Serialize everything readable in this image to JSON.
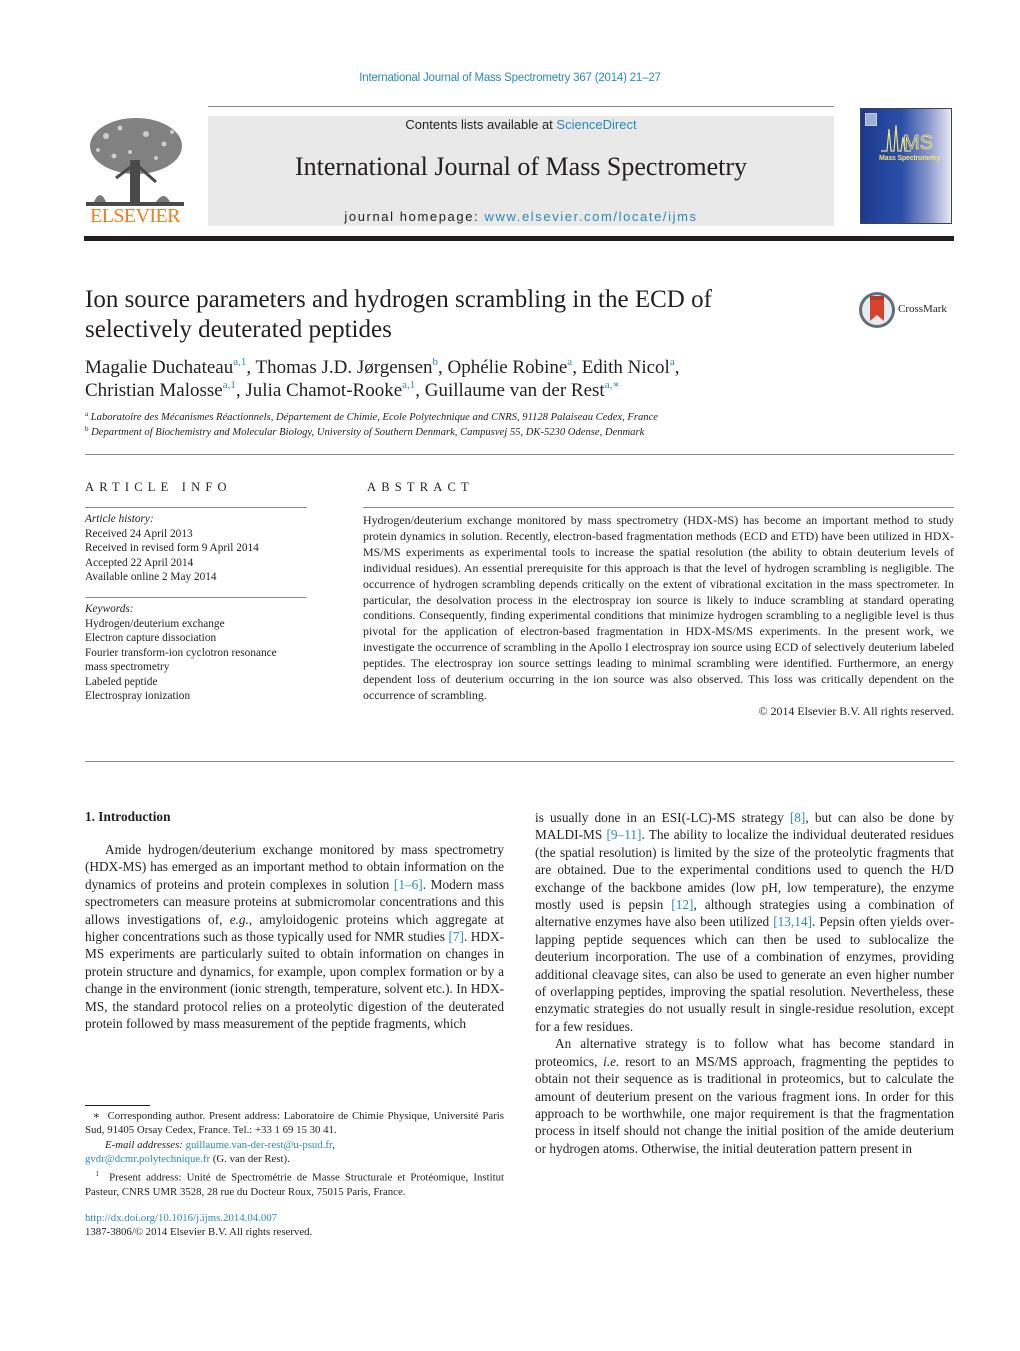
{
  "running_header": "International Journal of Mass Spectrometry 367 (2014) 21–27",
  "masthead": {
    "publisher_logo_text": "ELSEVIER",
    "contents_prefix": "Contents lists available at ",
    "contents_link": "ScienceDirect",
    "journal_name": "International Journal of Mass Spectrometry",
    "homepage_prefix": "journal homepage: ",
    "homepage_link": "www.elsevier.com/locate/ijms",
    "cover_title": "Mass Spectrometry"
  },
  "article": {
    "title_line1": "Ion source parameters and hydrogen scrambling in the ECD of",
    "title_line2": "selectively deuterated peptides",
    "crossmark_label": "CrossMark",
    "authors": [
      {
        "name": "Magalie Duchateau",
        "sup": "a,1",
        "sep": ", "
      },
      {
        "name": "Thomas J.D. Jørgensen",
        "sup": "b",
        "sep": ", "
      },
      {
        "name": "Ophélie Robine",
        "sup": "a",
        "sep": ", "
      },
      {
        "name": "Edith Nicol",
        "sup": "a",
        "sep": ","
      },
      {
        "name": "Christian Malosse",
        "sup": "a,1",
        "sep": ", "
      },
      {
        "name": "Julia Chamot-Rooke",
        "sup": "a,1",
        "sep": ", "
      },
      {
        "name": "Guillaume van der Rest",
        "sup": "a,∗",
        "sep": ""
      }
    ],
    "affiliations": [
      {
        "label": "a",
        "text": "Laboratoire des Mécanismes Réactionnels, Département de Chimie, Ecole Polytechnique and CNRS, 91128 Palaiseau Cedex, France"
      },
      {
        "label": "b",
        "text": "Department of Biochemistry and Molecular Biology, University of Southern Denmark, Campusvej 55, DK-5230 Odense, Denmark"
      }
    ]
  },
  "article_info": {
    "heading": "ARTICLE INFO",
    "history_label": "Article history:",
    "history": [
      "Received 24 April 2013",
      "Received in revised form 9 April 2014",
      "Accepted 22 April 2014",
      "Available online 2 May 2014"
    ],
    "keywords_label": "Keywords:",
    "keywords": [
      "Hydrogen/deuterium exchange",
      "Electron capture dissociation",
      "Fourier transform-ion cyclotron resonance",
      "mass spectrometry",
      "Labeled peptide",
      "Electrospray ionization"
    ]
  },
  "abstract": {
    "heading": "ABSTRACT",
    "text": "Hydrogen/deuterium exchange monitored by mass spectrometry (HDX-MS) has become an important method to study protein dynamics in solution. Recently, electron-based fragmentation methods (ECD and ETD) have been utilized in HDX-MS/MS experiments as experimental tools to increase the spatial resolution (the ability to obtain deuterium levels of individual residues). An essential prerequisite for this approach is that the level of hydrogen scrambling is negligible. The occurrence of hydrogen scram­bling depends critically on the extent of vibrational excitation in the mass spectrometer. In particular, the desolvation process in the electrospray ion source is likely to induce scrambling at standard operat­ing conditions. Consequently, finding experimental conditions that minimize hydrogen scrambling to a negligible level is thus pivotal for the application of electron-based fragmentation in HDX-MS/MS exper­iments. In the present work, we investigate the occurrence of scrambling in the Apollo I electrospray ion source using ECD of selectively deuterium labeled peptides. The electrospray ion source settings leading to minimal scrambling were identified. Furthermore, an energy dependent loss of deuterium occurring in the ion source was also observed. This loss was critically dependent on the occurrence of scrambling.",
    "copyright": "© 2014 Elsevier B.V. All rights reserved."
  },
  "introduction": {
    "heading": "1.  Introduction",
    "left_p1": [
      {
        "t": "Amide hydrogen/deuterium exchange monitored by mass spec­trometry (HDX-MS) has emerged as an important method to obtain information on the dynamics of proteins and protein complexes in solution "
      },
      {
        "ref": "[1–6]"
      },
      {
        "t": ". Modern mass spectrometers can measure proteins at submicromolar concentrations and this allows investigations of, "
      },
      {
        "i": "e.g."
      },
      {
        "t": ", amyloidogenic proteins which aggregate at higher con­centrations such as those typically used for NMR studies "
      },
      {
        "ref": "[7]"
      },
      {
        "t": ". HDX-MS experiments are particularly suited to obtain informa­tion on changes in protein structure and dynamics, for example, upon complex formation or by a change in the environment (ionic strength, temperature, solvent etc.). In HDX-MS, the standard pro­tocol relies on a proteolytic digestion of the deuterated protein followed by mass measurement of the peptide fragments, which"
      }
    ],
    "right_p1": [
      {
        "t": "is usually done in an ESI(-LC)-MS strategy "
      },
      {
        "ref": "[8]"
      },
      {
        "t": ", but can also be done by MALDI-MS "
      },
      {
        "ref": "[9–11]"
      },
      {
        "t": ". The ability to localize the individual deuter­ated residues (the spatial resolution) is limited by the size of the proteolytic fragments that are obtained. Due to the experimen­tal conditions used to quench the H/D exchange of the backbone amides (low pH, low temperature), the enzyme mostly used is pepsin "
      },
      {
        "ref": "[12]"
      },
      {
        "t": ", although strategies using a combination of alternative enzymes have also been utilized "
      },
      {
        "ref": "[13,14]"
      },
      {
        "t": ". Pepsin often yields over­lapping peptide sequences which can then be used to sublocalize the deuterium incorporation. The use of a combination of enzymes, providing additional cleavage sites, can also be used to generate an even higher number of overlapping peptides, improving the spatial resolution. Nevertheless, these enzymatic strategies do not usually result in single-residue resolution, except for a few residues."
      }
    ],
    "right_p2": [
      {
        "t": "An alternative strategy is to follow what has become standard in proteomics, "
      },
      {
        "i": "i.e."
      },
      {
        "t": " resort to an MS/MS approach, fragmenting the pep­tides to obtain not their sequence as is traditional in proteomics, but to calculate the amount of deuterium present on the various fragment ions. In order for this approach to be worthwhile, one major requirement is that the fragmentation process in itself should not change the initial position of the amide deuterium or hydro­gen atoms. Otherwise, the initial deuteration pattern present in"
      }
    ]
  },
  "footnotes": {
    "corresponding_mark": "∗",
    "corresponding_text": "Corresponding author. Present address: Laboratoire de Chimie Physique, Uni­versité Paris Sud, 91405 Orsay Cedex, France. Tel.: +33 1 69 15 30 41.",
    "email_label": "E-mail addresses:",
    "email1": "guillaume.van-der-rest@u-psud.fr",
    "email2": "gvdr@dcmr.polytechnique.fr",
    "email_owner": "(G. van der Rest).",
    "note1_mark": "1",
    "note1_text": "Present address: Unité de Spectrométrie de Masse Structurale et Protéomique, Institut Pasteur, CNRS UMR 3528, 28 rue du Docteur Roux, 75015 Paris, France.",
    "doi": "http://dx.doi.org/10.1016/j.ijms.2014.04.007",
    "issn_line": "1387-3806/© 2014 Elsevier B.V. All rights reserved."
  },
  "colors": {
    "link": "#2a8ab8",
    "elsevier_orange": "#f07d1a",
    "masthead_bg": "#e9e9e9",
    "crossmark_red": "#d5432b"
  }
}
